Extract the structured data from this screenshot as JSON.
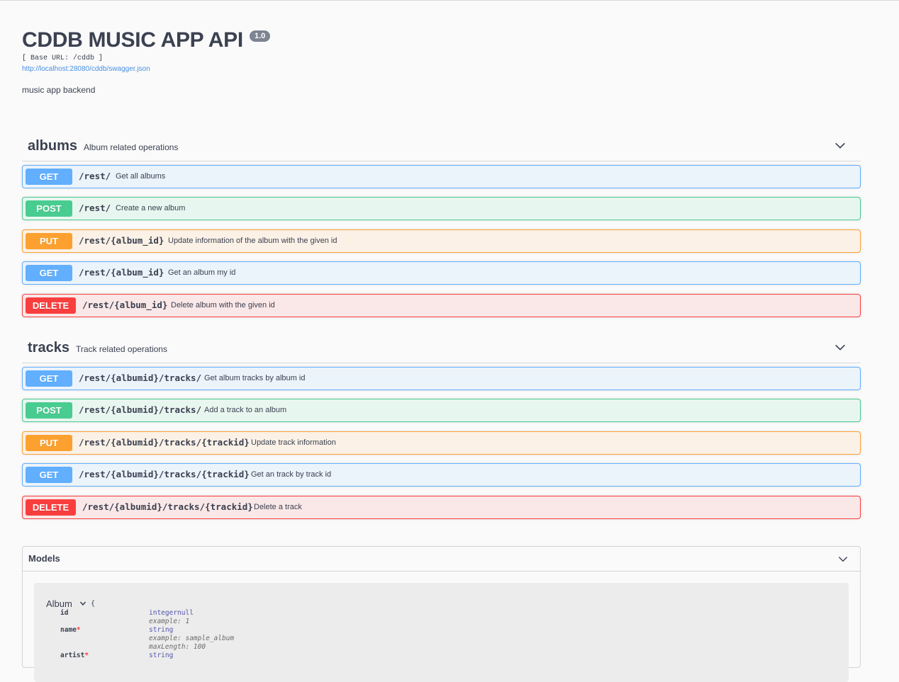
{
  "info": {
    "title": "CDDB MUSIC APP API",
    "version": "1.0",
    "base_url": "[ Base URL: /cddb ]",
    "spec_url": "http://localhost:28080/cddb/swagger.json",
    "description": "music app backend"
  },
  "tags": [
    {
      "name": "albums",
      "description": "Album related operations",
      "operations": [
        {
          "method": "GET",
          "path": "/rest/",
          "summary": "Get all albums"
        },
        {
          "method": "POST",
          "path": "/rest/",
          "summary": "Create a new album"
        },
        {
          "method": "PUT",
          "path": "/rest/{album_id}",
          "summary": "Update information of the album with the given id"
        },
        {
          "method": "GET",
          "path": "/rest/{album_id}",
          "summary": "Get an album my id"
        },
        {
          "method": "DELETE",
          "path": "/rest/{album_id}",
          "summary": "Delete album with the given id"
        }
      ]
    },
    {
      "name": "tracks",
      "description": "Track related operations",
      "operations": [
        {
          "method": "GET",
          "path": "/rest/{albumid}/tracks/",
          "summary": "Get album tracks by album id"
        },
        {
          "method": "POST",
          "path": "/rest/{albumid}/tracks/",
          "summary": "Add a track to an album"
        },
        {
          "method": "PUT",
          "path": "/rest/{albumid}/tracks/{trackid}",
          "summary": "Update track information"
        },
        {
          "method": "GET",
          "path": "/rest/{albumid}/tracks/{trackid}",
          "summary": "Get an track by track id"
        },
        {
          "method": "DELETE",
          "path": "/rest/{albumid}/tracks/{trackid}",
          "summary": "Delete a track"
        }
      ]
    }
  ],
  "models": {
    "title": "Models",
    "album": {
      "name": "Album",
      "open_brace": "{",
      "properties": [
        {
          "name": "id",
          "required": false,
          "type": "integernull",
          "meta": [
            "example: 1"
          ]
        },
        {
          "name": "name",
          "required": true,
          "type": "string",
          "meta": [
            "example: sample_album",
            "maxLength: 100"
          ]
        },
        {
          "name": "artist",
          "required": true,
          "type": "string",
          "meta": []
        }
      ]
    }
  },
  "colors": {
    "get": "#61affe",
    "post": "#49cc90",
    "put": "#fca130",
    "delete": "#f93e3e",
    "link": "#4990e2"
  },
  "icons": {
    "section_toggle": "chevron-down-icon",
    "model_toggle": "chevron-down-icon"
  }
}
